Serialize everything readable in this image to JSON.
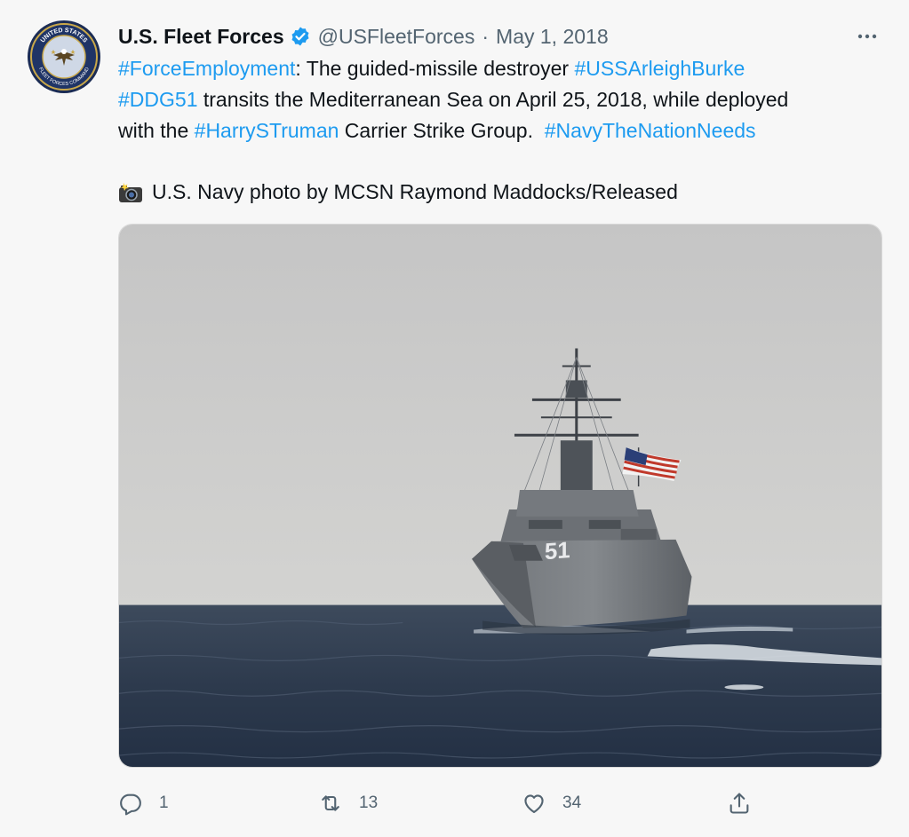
{
  "tweet": {
    "author": {
      "name": "U.S. Fleet Forces",
      "handle": "@USFleetForces",
      "verified": true,
      "avatar_icon": "fleet-forces-command-seal",
      "avatar_text_top": "UNITED STATES",
      "avatar_text_bottom": "FLEET FORCES COMMAND"
    },
    "separator": "·",
    "date": "May 1, 2018",
    "more_icon": "more-horizontal-icon",
    "lines": [
      [
        {
          "text": "#ForceEmployment",
          "hashtag": true
        },
        {
          "text": ": The guided-missile destroyer ",
          "hashtag": false
        },
        {
          "text": "#USSArleighBurke",
          "hashtag": true
        }
      ],
      [
        {
          "text": "#DDG51",
          "hashtag": true
        },
        {
          "text": " transits the Mediterranean Sea on April 25, 2018, while deployed",
          "hashtag": false
        }
      ],
      [
        {
          "text": "with the ",
          "hashtag": false
        },
        {
          "text": "#HarrySTruman",
          "hashtag": true
        },
        {
          "text": " Carrier Strike Group.  ",
          "hashtag": false
        },
        {
          "text": "#NavyTheNationNeeds",
          "hashtag": true
        }
      ]
    ],
    "credit_icon": "camera-flash-emoji",
    "credit": "U.S. Navy photo by MCSN Raymond Maddocks/Released",
    "photo": {
      "subject": "guided-missile destroyer with hull number 51 flying U.S. flag at sea",
      "hull_number": "51"
    },
    "actions": {
      "reply": {
        "icon": "reply-icon",
        "count": "1"
      },
      "retweet": {
        "icon": "retweet-icon",
        "count": "13"
      },
      "like": {
        "icon": "heart-icon",
        "count": "34"
      },
      "share": {
        "icon": "share-icon"
      }
    }
  },
  "colors": {
    "background": "#f7f7f7",
    "text": "#0f1419",
    "secondary": "#536471",
    "hashtag": "#1d9bf0",
    "verified": "#1d9bf0"
  }
}
